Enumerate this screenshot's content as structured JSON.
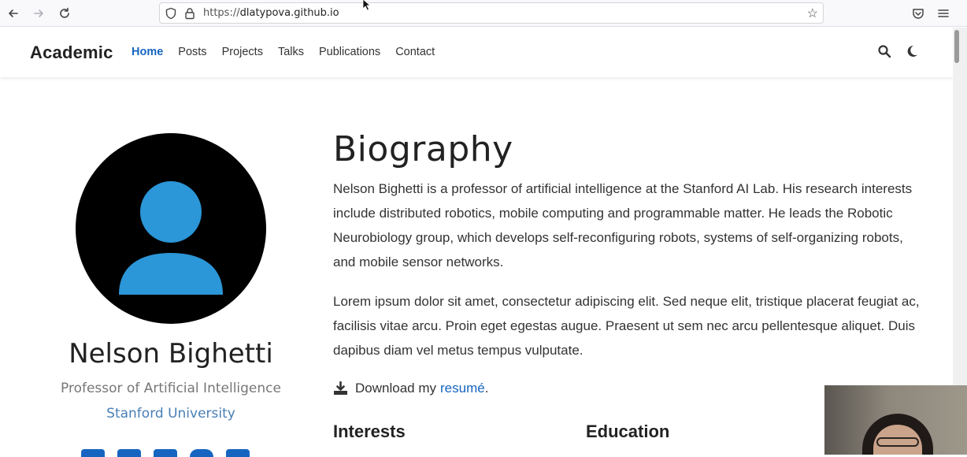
{
  "browser": {
    "url_prefix": "https://",
    "url_host": "dlatypova.github.io"
  },
  "navbar": {
    "brand": "Academic",
    "items": [
      {
        "label": "Home",
        "active": true
      },
      {
        "label": "Posts",
        "active": false
      },
      {
        "label": "Projects",
        "active": false
      },
      {
        "label": "Talks",
        "active": false
      },
      {
        "label": "Publications",
        "active": false
      },
      {
        "label": "Contact",
        "active": false
      }
    ]
  },
  "profile": {
    "name": "Nelson Bighetti",
    "role": "Professor of Artificial Intelligence",
    "organization": "Stanford University",
    "avatar_color": "#2b96d8"
  },
  "biography": {
    "title": "Biography",
    "paragraph1": "Nelson Bighetti is a professor of artificial intelligence at the Stanford AI Lab. His research interests include distributed robotics, mobile computing and programmable matter. He leads the Robotic Neurobiology group, which develops self-reconfiguring robots, systems of self-organizing robots, and mobile sensor networks.",
    "paragraph2": "Lorem ipsum dolor sit amet, consectetur adipiscing elit. Sed neque elit, tristique placerat feugiat ac, facilisis vitae arcu. Proin eget egestas augue. Praesent ut sem nec arcu pellentesque aliquet. Duis dapibus diam vel metus tempus vulputate.",
    "download_prefix": "Download my",
    "resume_link": "resumé",
    "download_suffix": "."
  },
  "sections": {
    "interests": "Interests",
    "education": "Education"
  },
  "colors": {
    "accent": "#1565c0",
    "org_link": "#4a7fb5"
  }
}
